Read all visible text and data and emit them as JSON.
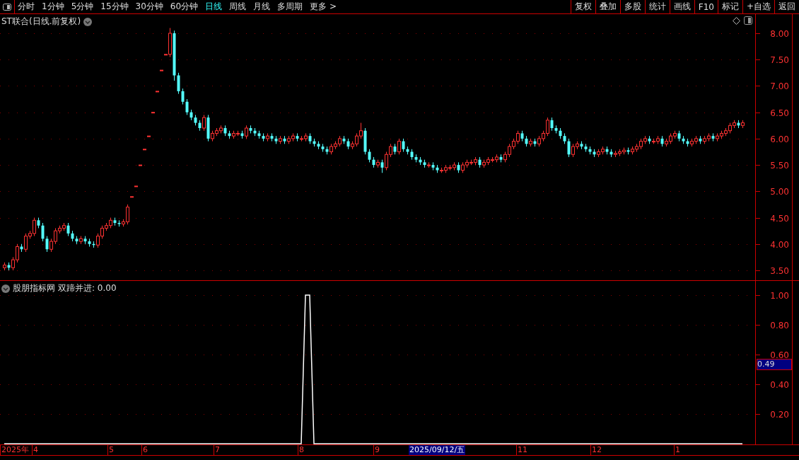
{
  "toolbar": {
    "periods": [
      {
        "label": "分时",
        "selected": false
      },
      {
        "label": "1分钟",
        "selected": false
      },
      {
        "label": "5分钟",
        "selected": false
      },
      {
        "label": "15分钟",
        "selected": false
      },
      {
        "label": "30分钟",
        "selected": false
      },
      {
        "label": "60分钟",
        "selected": false
      },
      {
        "label": "日线",
        "selected": true
      },
      {
        "label": "周线",
        "selected": false
      },
      {
        "label": "月线",
        "selected": false
      },
      {
        "label": "多周期",
        "selected": false
      },
      {
        "label": "更多 >",
        "selected": false
      }
    ],
    "buttons": [
      "复权",
      "叠加",
      "多股",
      "统计",
      "画线",
      "F10",
      "标记",
      "+自选",
      "返回"
    ]
  },
  "price_chart": {
    "title": "ST联合(日线.前复权)",
    "chart_data": {
      "type": "candlestick",
      "grid": true,
      "ylim": [
        3.5,
        8.0
      ],
      "yticks": [
        {
          "value": 3.5,
          "label": "3.50"
        },
        {
          "value": 4,
          "label": "4.00"
        },
        {
          "value": 4.5,
          "label": "4.50"
        },
        {
          "value": 5,
          "label": "5.00"
        },
        {
          "value": 5.5,
          "label": "5.50"
        },
        {
          "value": 6,
          "label": "6.00"
        },
        {
          "value": 6.5,
          "label": "6.50"
        },
        {
          "value": 7,
          "label": "7.00"
        },
        {
          "value": 7.5,
          "label": "7.50"
        },
        {
          "value": 8,
          "label": "8.00"
        }
      ],
      "ohlc": [
        [
          3.55,
          3.65,
          3.5,
          3.6
        ],
        [
          3.6,
          3.65,
          3.5,
          3.55
        ],
        [
          3.55,
          3.75,
          3.5,
          3.7
        ],
        [
          3.7,
          4.0,
          3.65,
          3.95
        ],
        [
          3.95,
          4.0,
          3.85,
          3.9
        ],
        [
          3.9,
          4.2,
          3.85,
          4.15
        ],
        [
          4.15,
          4.25,
          4.1,
          4.2
        ],
        [
          4.2,
          4.5,
          4.15,
          4.45
        ],
        [
          4.45,
          4.5,
          4.3,
          4.35
        ],
        [
          4.35,
          4.4,
          4.05,
          4.1
        ],
        [
          4.1,
          4.15,
          3.85,
          3.9
        ],
        [
          3.9,
          4.1,
          3.85,
          4.05
        ],
        [
          4.05,
          4.3,
          4.0,
          4.25
        ],
        [
          4.25,
          4.35,
          4.2,
          4.3
        ],
        [
          4.3,
          4.4,
          4.25,
          4.35
        ],
        [
          4.35,
          4.4,
          4.15,
          4.2
        ],
        [
          4.2,
          4.25,
          4.05,
          4.1
        ],
        [
          4.1,
          4.15,
          4.0,
          4.05
        ],
        [
          4.05,
          4.15,
          4.0,
          4.1
        ],
        [
          4.1,
          4.15,
          4.0,
          4.05
        ],
        [
          4.05,
          4.1,
          3.95,
          4.0
        ],
        [
          4.0,
          4.05,
          3.93,
          3.98
        ],
        [
          3.98,
          4.2,
          3.93,
          4.15
        ],
        [
          4.15,
          4.35,
          4.1,
          4.3
        ],
        [
          4.3,
          4.4,
          4.25,
          4.35
        ],
        [
          4.35,
          4.5,
          4.3,
          4.45
        ],
        [
          4.45,
          4.5,
          4.35,
          4.4
        ],
        [
          4.4,
          4.45,
          4.33,
          4.38
        ],
        [
          4.38,
          4.47,
          4.33,
          4.42
        ],
        [
          4.42,
          4.75,
          4.37,
          4.7
        ],
        [
          4.9,
          4.9,
          4.9,
          4.9
        ],
        [
          5.1,
          5.1,
          5.1,
          5.1
        ],
        [
          5.5,
          5.5,
          5.5,
          5.5
        ],
        [
          5.8,
          5.8,
          5.8,
          5.8
        ],
        [
          6.05,
          6.05,
          6.05,
          6.05
        ],
        [
          6.5,
          6.5,
          6.5,
          6.5
        ],
        [
          6.9,
          6.9,
          6.9,
          6.9
        ],
        [
          7.3,
          7.3,
          7.3,
          7.3
        ],
        [
          7.6,
          7.6,
          7.6,
          7.6
        ],
        [
          7.6,
          8.1,
          7.55,
          8.0
        ],
        [
          8.0,
          8.05,
          7.1,
          7.2
        ],
        [
          7.2,
          7.25,
          6.85,
          6.9
        ],
        [
          6.9,
          6.95,
          6.65,
          6.7
        ],
        [
          6.7,
          6.75,
          6.45,
          6.5
        ],
        [
          6.5,
          6.55,
          6.35,
          6.4
        ],
        [
          6.4,
          6.45,
          6.25,
          6.3
        ],
        [
          6.3,
          6.35,
          6.15,
          6.2
        ],
        [
          6.2,
          6.45,
          6.15,
          6.4
        ],
        [
          6.4,
          6.45,
          5.95,
          6.0
        ],
        [
          6.0,
          6.15,
          5.95,
          6.1
        ],
        [
          6.1,
          6.2,
          6.05,
          6.15
        ],
        [
          6.15,
          6.25,
          6.1,
          6.2
        ],
        [
          6.2,
          6.25,
          6.05,
          6.1
        ],
        [
          6.1,
          6.15,
          6.0,
          6.05
        ],
        [
          6.05,
          6.15,
          6.0,
          6.1
        ],
        [
          6.1,
          6.15,
          6.05,
          6.1
        ],
        [
          6.1,
          6.15,
          6.0,
          6.05
        ],
        [
          6.05,
          6.25,
          6.0,
          6.2
        ],
        [
          6.2,
          6.25,
          6.1,
          6.15
        ],
        [
          6.15,
          6.2,
          6.05,
          6.1
        ],
        [
          6.1,
          6.15,
          6.0,
          6.05
        ],
        [
          6.05,
          6.1,
          5.95,
          6.0
        ],
        [
          6.0,
          6.1,
          5.95,
          6.05
        ],
        [
          6.05,
          6.1,
          5.95,
          6.0
        ],
        [
          6.0,
          6.05,
          5.9,
          5.95
        ],
        [
          5.95,
          6.05,
          5.9,
          6.0
        ],
        [
          6.0,
          6.05,
          5.9,
          5.95
        ],
        [
          5.95,
          6.05,
          5.9,
          6.0
        ],
        [
          6.0,
          6.1,
          5.95,
          6.05
        ],
        [
          6.05,
          6.1,
          5.95,
          6.0
        ],
        [
          6.0,
          6.05,
          5.95,
          6.0
        ],
        [
          6.0,
          6.1,
          5.95,
          6.05
        ],
        [
          6.05,
          6.1,
          5.9,
          5.95
        ],
        [
          5.95,
          6.0,
          5.85,
          5.9
        ],
        [
          5.9,
          5.95,
          5.8,
          5.85
        ],
        [
          5.85,
          5.9,
          5.75,
          5.8
        ],
        [
          5.8,
          5.85,
          5.7,
          5.75
        ],
        [
          5.75,
          5.9,
          5.7,
          5.85
        ],
        [
          5.85,
          5.95,
          5.8,
          5.9
        ],
        [
          5.9,
          6.05,
          5.85,
          6.0
        ],
        [
          6.0,
          6.05,
          5.9,
          5.95
        ],
        [
          5.95,
          6.0,
          5.8,
          5.85
        ],
        [
          5.85,
          5.95,
          5.8,
          5.9
        ],
        [
          5.9,
          6.1,
          5.85,
          6.05
        ],
        [
          6.05,
          6.3,
          6.0,
          6.15
        ],
        [
          6.15,
          6.2,
          5.7,
          5.75
        ],
        [
          5.75,
          5.8,
          5.55,
          5.6
        ],
        [
          5.6,
          5.65,
          5.45,
          5.5
        ],
        [
          5.5,
          5.6,
          5.45,
          5.55
        ],
        [
          5.55,
          5.6,
          5.35,
          5.45
        ],
        [
          5.45,
          5.75,
          5.4,
          5.7
        ],
        [
          5.7,
          5.9,
          5.65,
          5.85
        ],
        [
          5.85,
          5.9,
          5.7,
          5.75
        ],
        [
          5.75,
          6.0,
          5.7,
          5.95
        ],
        [
          5.95,
          6.0,
          5.75,
          5.8
        ],
        [
          5.8,
          5.85,
          5.7,
          5.75
        ],
        [
          5.75,
          5.8,
          5.6,
          5.65
        ],
        [
          5.65,
          5.7,
          5.55,
          5.6
        ],
        [
          5.6,
          5.65,
          5.5,
          5.55
        ],
        [
          5.55,
          5.6,
          5.45,
          5.5
        ],
        [
          5.5,
          5.55,
          5.45,
          5.5
        ],
        [
          5.5,
          5.55,
          5.4,
          5.45
        ],
        [
          5.45,
          5.5,
          5.35,
          5.4
        ],
        [
          5.4,
          5.45,
          5.35,
          5.4
        ],
        [
          5.4,
          5.5,
          5.35,
          5.45
        ],
        [
          5.45,
          5.5,
          5.4,
          5.45
        ],
        [
          5.45,
          5.55,
          5.4,
          5.5
        ],
        [
          5.5,
          5.55,
          5.35,
          5.4
        ],
        [
          5.4,
          5.55,
          5.35,
          5.5
        ],
        [
          5.5,
          5.6,
          5.45,
          5.55
        ],
        [
          5.55,
          5.6,
          5.5,
          5.55
        ],
        [
          5.55,
          5.65,
          5.5,
          5.6
        ],
        [
          5.6,
          5.65,
          5.45,
          5.5
        ],
        [
          5.5,
          5.6,
          5.45,
          5.55
        ],
        [
          5.55,
          5.65,
          5.5,
          5.6
        ],
        [
          5.6,
          5.65,
          5.55,
          5.6
        ],
        [
          5.6,
          5.7,
          5.55,
          5.65
        ],
        [
          5.65,
          5.7,
          5.55,
          5.6
        ],
        [
          5.6,
          5.75,
          5.55,
          5.7
        ],
        [
          5.7,
          5.9,
          5.65,
          5.85
        ],
        [
          5.85,
          6.0,
          5.8,
          5.95
        ],
        [
          5.95,
          6.15,
          5.9,
          6.1
        ],
        [
          6.1,
          6.15,
          5.95,
          6.0
        ],
        [
          6.0,
          6.05,
          5.85,
          5.9
        ],
        [
          5.9,
          6.0,
          5.85,
          5.95
        ],
        [
          5.95,
          6.0,
          5.85,
          5.9
        ],
        [
          5.9,
          6.05,
          5.85,
          6.0
        ],
        [
          6.0,
          6.15,
          5.95,
          6.1
        ],
        [
          6.1,
          6.4,
          6.05,
          6.35
        ],
        [
          6.35,
          6.4,
          6.15,
          6.2
        ],
        [
          6.2,
          6.25,
          6.1,
          6.15
        ],
        [
          6.15,
          6.2,
          6.0,
          6.05
        ],
        [
          6.05,
          6.1,
          5.9,
          5.95
        ],
        [
          5.95,
          6.0,
          5.65,
          5.7
        ],
        [
          5.7,
          5.9,
          5.65,
          5.85
        ],
        [
          5.85,
          5.95,
          5.8,
          5.9
        ],
        [
          5.9,
          5.95,
          5.8,
          5.85
        ],
        [
          5.85,
          5.9,
          5.75,
          5.8
        ],
        [
          5.8,
          5.85,
          5.7,
          5.75
        ],
        [
          5.75,
          5.8,
          5.65,
          5.7
        ],
        [
          5.7,
          5.8,
          5.65,
          5.75
        ],
        [
          5.75,
          5.85,
          5.7,
          5.8
        ],
        [
          5.8,
          5.85,
          5.7,
          5.75
        ],
        [
          5.75,
          5.8,
          5.65,
          5.7
        ],
        [
          5.7,
          5.77,
          5.65,
          5.72
        ],
        [
          5.72,
          5.8,
          5.67,
          5.75
        ],
        [
          5.75,
          5.83,
          5.7,
          5.78
        ],
        [
          5.78,
          5.83,
          5.7,
          5.75
        ],
        [
          5.75,
          5.85,
          5.7,
          5.8
        ],
        [
          5.8,
          5.9,
          5.75,
          5.85
        ],
        [
          5.85,
          6.0,
          5.8,
          5.95
        ],
        [
          5.95,
          6.05,
          5.9,
          6.0
        ],
        [
          6.0,
          6.05,
          5.9,
          5.95
        ],
        [
          5.95,
          6.0,
          5.9,
          5.95
        ],
        [
          5.95,
          6.05,
          5.9,
          6.0
        ],
        [
          6.0,
          6.05,
          5.85,
          5.9
        ],
        [
          5.9,
          6.0,
          5.85,
          5.95
        ],
        [
          5.95,
          6.1,
          5.9,
          6.05
        ],
        [
          6.05,
          6.15,
          6.0,
          6.1
        ],
        [
          6.1,
          6.15,
          5.95,
          6.0
        ],
        [
          6.0,
          6.05,
          5.9,
          5.95
        ],
        [
          5.95,
          6.0,
          5.85,
          5.9
        ],
        [
          5.9,
          6.0,
          5.85,
          5.95
        ],
        [
          5.95,
          6.05,
          5.9,
          6.0
        ],
        [
          6.0,
          6.05,
          5.9,
          5.95
        ],
        [
          5.95,
          6.05,
          5.9,
          6.0
        ],
        [
          6.0,
          6.1,
          5.95,
          6.05
        ],
        [
          6.05,
          6.1,
          5.95,
          6.0
        ],
        [
          6.0,
          6.1,
          5.95,
          6.05
        ],
        [
          6.05,
          6.15,
          6.0,
          6.1
        ],
        [
          6.1,
          6.2,
          6.05,
          6.15
        ],
        [
          6.15,
          6.3,
          6.1,
          6.25
        ],
        [
          6.25,
          6.35,
          6.2,
          6.3
        ],
        [
          6.3,
          6.35,
          6.2,
          6.25
        ],
        [
          6.25,
          6.35,
          6.2,
          6.3
        ]
      ]
    }
  },
  "indicator": {
    "source": "股朋指标网",
    "reading": "双蹄并进: 0.00",
    "cursor_value": "0.49",
    "chart_data": {
      "type": "line",
      "grid": true,
      "ylim": [
        0,
        1
      ],
      "yticks": [
        {
          "value": 0.2,
          "label": "0.20"
        },
        {
          "value": 0.4,
          "label": "0.40"
        },
        {
          "value": 0.6,
          "label": "0.60"
        },
        {
          "value": 0.8,
          "label": "0.80"
        },
        {
          "value": 1,
          "label": "1.00"
        }
      ],
      "series": [
        {
          "color": "#ffffff",
          "values": [
            0,
            0,
            0,
            0,
            0,
            0,
            0,
            0,
            0,
            0,
            0,
            0,
            0,
            0,
            0,
            0,
            0,
            0,
            0,
            0,
            0,
            0,
            0,
            0,
            0,
            0,
            0,
            0,
            0,
            0,
            0,
            0,
            0,
            0,
            0,
            0,
            0,
            0,
            0,
            0,
            0,
            0,
            0,
            0,
            0,
            0,
            0,
            0,
            0,
            0,
            0,
            0,
            0,
            0,
            0,
            0,
            0,
            0,
            0,
            0,
            0,
            0,
            0,
            0,
            0,
            0,
            0,
            0,
            0,
            0,
            0,
            1,
            1,
            0,
            0,
            0,
            0,
            0,
            0,
            0,
            0,
            0,
            0,
            0,
            0,
            0,
            0,
            0,
            0,
            0,
            0,
            0,
            0,
            0,
            0,
            0,
            0,
            0,
            0,
            0,
            0,
            0,
            0,
            0,
            0,
            0,
            0,
            0,
            0,
            0,
            0,
            0,
            0,
            0,
            0,
            0,
            0,
            0,
            0,
            0,
            0,
            0,
            0,
            0,
            0,
            0,
            0,
            0,
            0,
            0,
            0,
            0,
            0,
            0,
            0,
            0,
            0,
            0,
            0,
            0,
            0,
            0,
            0,
            0,
            0,
            0,
            0,
            0,
            0,
            0,
            0,
            0,
            0,
            0,
            0,
            0,
            0,
            0,
            0,
            0,
            0,
            0,
            0,
            0,
            0,
            0,
            0,
            0,
            0,
            0,
            0,
            0,
            0,
            0,
            0
          ]
        }
      ]
    }
  },
  "x_axis": {
    "ticks": [
      "2025年",
      "4",
      "5",
      "6",
      "7",
      "8",
      "9",
      "11",
      "12",
      "1"
    ],
    "cursor_date": "2025/09/12/五"
  }
}
